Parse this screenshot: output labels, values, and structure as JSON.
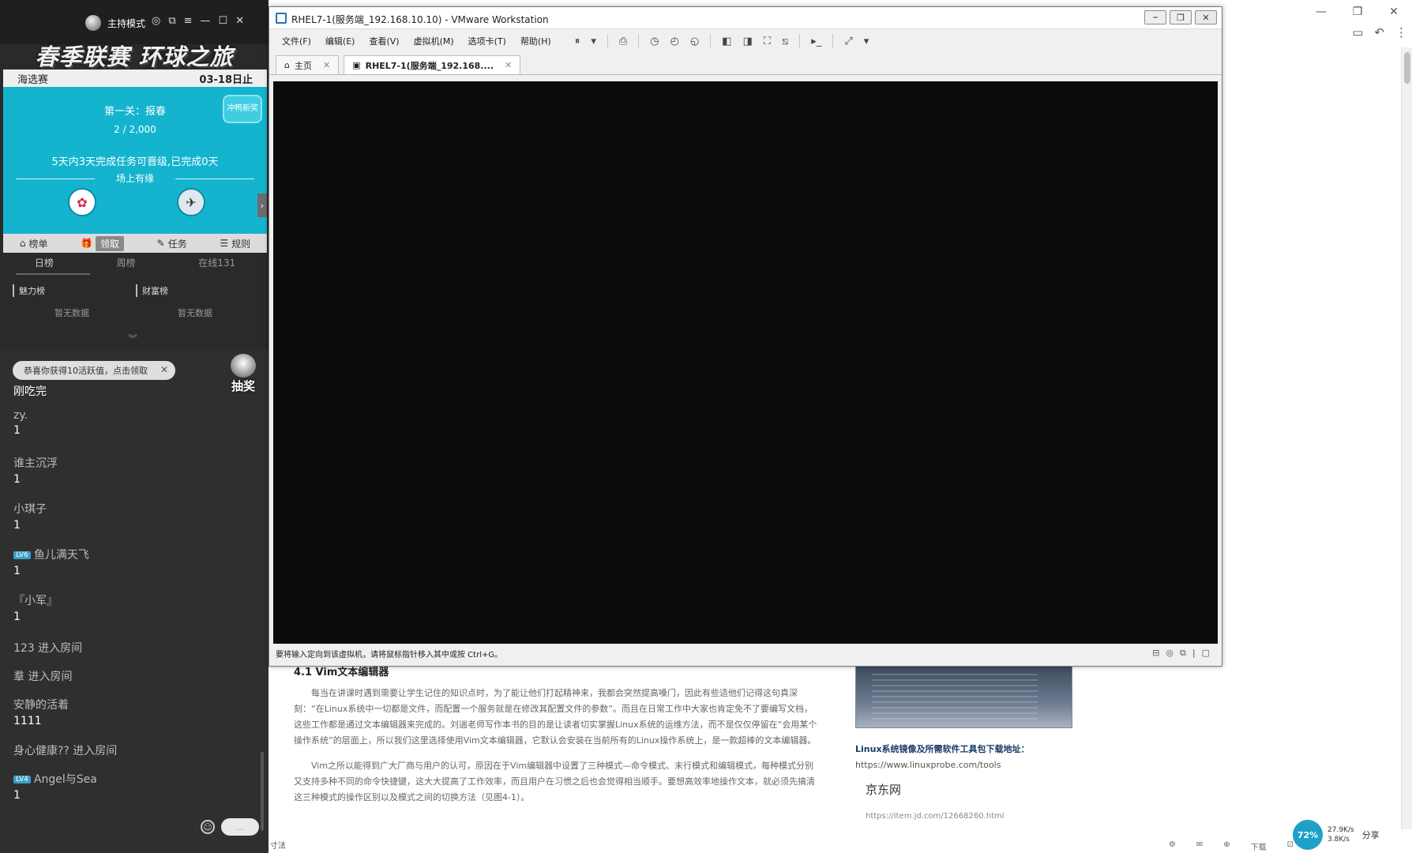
{
  "background_browser": {
    "window_controls": [
      "—",
      "❐",
      "✕"
    ],
    "toolbar_icons": [
      "▭",
      "↶",
      "⋮"
    ],
    "article": {
      "heading": "4.1 Vim文本编辑器",
      "paragraphs": [
        "每当在讲课时遇到需要让学生记住的知识点时，为了能让他们打起精神来，我都会突然提高嗓门，因此有些适他们记得这句真深刻：“在Linux系统中一切都是文件，而配置一个服务就是在修改其配置文件的参数”。而且在日常工作中大家也肯定免不了要编写文档，这些工作都是通过文本编辑器来完成的。刘遄老师写作本书的目的是让读者切实掌握Linux系统的运维方法，而不是仅仅停留在“会用某个操作系统”的层面上，所以我们这里选择使用Vim文本编辑器，它默认会安装在当前所有的Linux操作系统上，是一款超棒的文本编辑器。",
        "Vim之所以能得到广大厂商与用户的认可，原因在于Vim编辑器中设置了三种模式—命令模式、末行模式和编辑模式，每种模式分别又支持多种不同的命令快捷键，这大大提高了工作效率，而且用户在习惯之后也会觉得相当顺手。要想高效率地操作文本，就必须先搞清这三种模式的操作区别以及模式之间的切换方法（见图4-1）。"
      ]
    },
    "ad": {
      "caption": "Linux系统镜像及所需软件工具包下载地址：",
      "link": "https://www.linuxprobe.com/tools",
      "jd_title": "京东网",
      "jd_link": "https://item.jd.com/12668260.html"
    },
    "net": {
      "percent": "72%",
      "up": "27.9K/s",
      "down": "3.8K/s",
      "share": "分享"
    },
    "bottom_status": "寸法",
    "bottom_icons": [
      "⚙",
      "✉",
      "⊕",
      "下载",
      "⊡"
    ]
  },
  "live_panel": {
    "mode_label": "主持模式",
    "controls": [
      "◎",
      "⧉",
      "≡",
      "—",
      "☐",
      "✕"
    ],
    "banner": "春季联赛  环球之旅",
    "race_name": "海选赛",
    "race_date": "03-18日止",
    "stage": "第一关：报春",
    "stage_progress": "2 / 2,000",
    "task_desc": "5天内3天完成任务可晋级,已完成0天",
    "fans_label": "场上有缘",
    "award_badge": "冲鸭新奖",
    "nav_tabs": [
      {
        "icon": "⌂",
        "label": "榜单"
      },
      {
        "icon": "🎁",
        "label": "领取"
      },
      {
        "icon": "✎",
        "label": "任务"
      },
      {
        "icon": "☰",
        "label": "规则"
      }
    ],
    "rank_tabs": [
      "日榜",
      "周榜",
      "在线131"
    ],
    "charm_rank": {
      "title": "魅力榜",
      "empty": "暂无数据"
    },
    "wealth_rank": {
      "title": "财富榜",
      "empty": "暂无数据"
    },
    "expand_chevron": "︾",
    "gift_tip": "恭喜你获得10活跃值，点击领取",
    "gift_tip_close": "✕",
    "lottery_label": "抽奖",
    "chat": [
      {
        "name": "",
        "text": "刚吃完"
      },
      {
        "name": "zy.",
        "text": "1"
      },
      {
        "name": "谁主沉浮",
        "text": "1"
      },
      {
        "name": "小琪子",
        "text": "1"
      },
      {
        "badge": "LV6",
        "name": "鱼儿满天飞",
        "text": "1"
      },
      {
        "name": "『小军』",
        "text": "1"
      }
    ],
    "enter_msgs": [
      "123 进入房间",
      "羣 进入房间"
    ],
    "chat_more": [
      {
        "name": "安静的活着",
        "text": "1111"
      }
    ],
    "enter_msg_3": "身心健康?? 进入房间",
    "chat_last": {
      "badge": "LV4",
      "name": "Angel与Sea",
      "text": "1"
    },
    "emoji": "☺",
    "send": "…"
  },
  "vmware": {
    "title": "RHEL7-1(服务端_192.168.10.10) - VMware Workstation",
    "window_controls": [
      "⎯",
      "❐",
      "✕"
    ],
    "menus": [
      "文件(F)",
      "编辑(E)",
      "查看(V)",
      "虚拟机(M)",
      "选项卡(T)",
      "帮助(H)"
    ],
    "tools": [
      "⏸",
      "▾",
      "⎙",
      "◷",
      "◴",
      "◵",
      "◧",
      "◨",
      "⛶",
      "⧅",
      "▸_",
      "⤢",
      "▾"
    ],
    "tabs": [
      {
        "label": "主页",
        "icon": "⌂"
      },
      {
        "label": "RHEL7-1(服务端_192.168....",
        "icon": "▣"
      }
    ],
    "status": "要将输入定向到该虚拟机，请将鼠标指针移入其中或按 Ctrl+G。",
    "status_icons": [
      "⊟",
      "◎",
      "⧉",
      "|",
      "▢"
    ]
  }
}
